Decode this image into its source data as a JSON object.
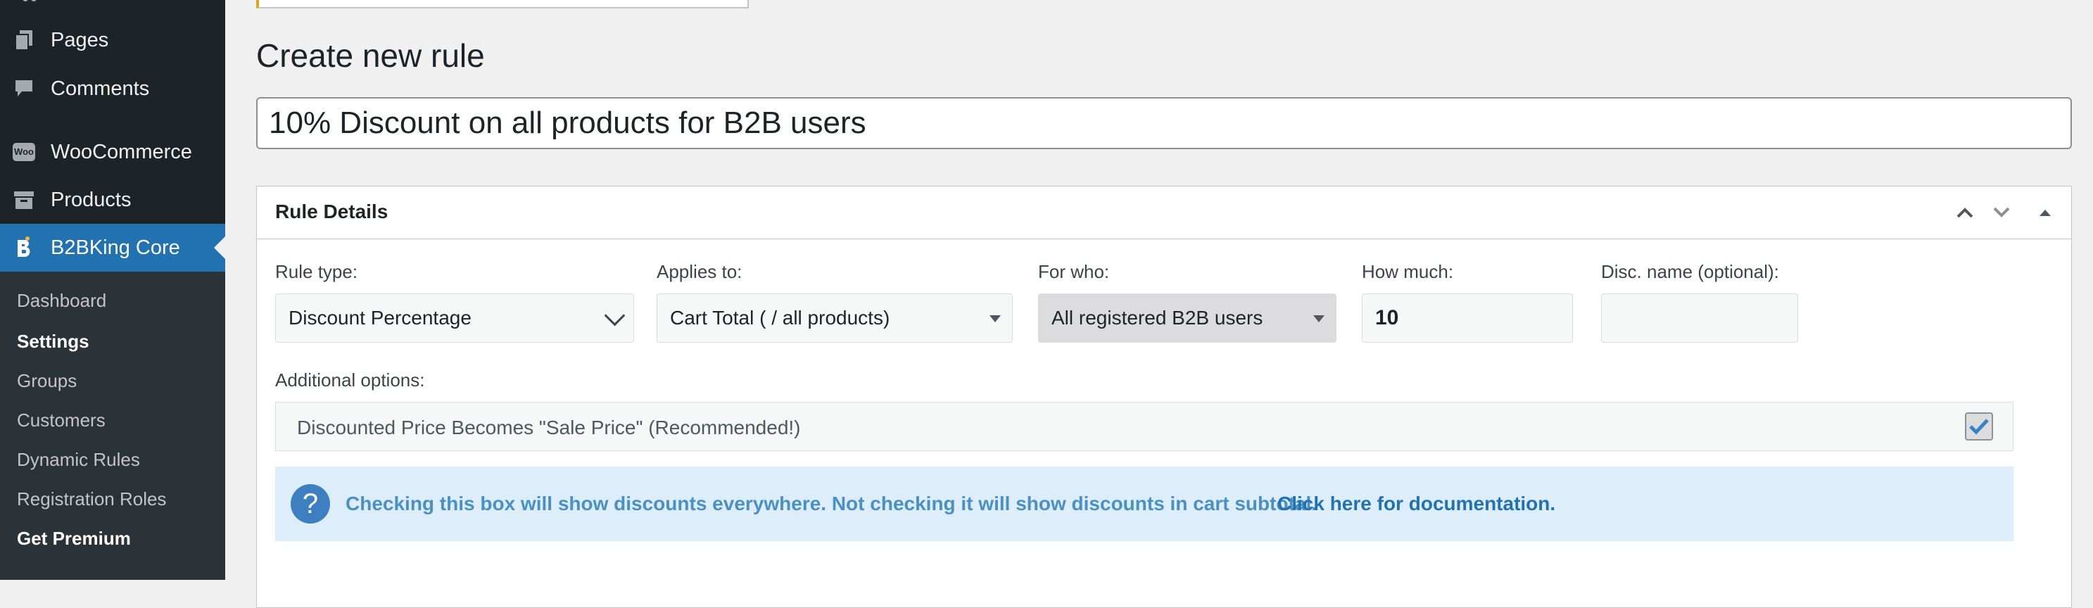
{
  "sidebar": {
    "items": [
      {
        "label": "Pages",
        "icon": "pages-icon"
      },
      {
        "label": "Comments",
        "icon": "comment-icon"
      },
      {
        "label": "WooCommerce",
        "icon": "woocommerce-icon",
        "icon_text": "Woo"
      },
      {
        "label": "Products",
        "icon": "products-icon"
      },
      {
        "label": "B2BKing Core",
        "icon": "b2bking-icon",
        "active": true
      }
    ],
    "submenu": [
      {
        "label": "Dashboard"
      },
      {
        "label": "Settings",
        "current": true
      },
      {
        "label": "Groups"
      },
      {
        "label": "Customers"
      },
      {
        "label": "Dynamic Rules"
      },
      {
        "label": "Registration Roles"
      },
      {
        "label": "Get Premium"
      }
    ]
  },
  "main": {
    "page_title": "Create new rule",
    "rule_title": "10% Discount on all products for B2B users",
    "postbox": {
      "title": "Rule Details",
      "fields": {
        "rule_type": {
          "label": "Rule type:",
          "value": "Discount Percentage"
        },
        "applies_to": {
          "label": "Applies to:",
          "value": "Cart Total ( / all products)"
        },
        "for_who": {
          "label": "For who:",
          "value": "All registered B2B users"
        },
        "how_much": {
          "label": "How much:",
          "value": "10"
        },
        "disc_name": {
          "label": "Disc. name (optional):",
          "value": ""
        }
      },
      "additional": {
        "label": "Additional options:",
        "option_text": "Discounted Price Becomes \"Sale Price\" (Recommended!)",
        "checked": true
      },
      "info": {
        "icon_text": "?",
        "text": "Checking this box will show discounts everywhere. Not checking it will show discounts in cart subtotal.",
        "link_text": "Click here for documentation."
      }
    }
  },
  "colors": {
    "sidebar_bg": "#1d2327",
    "submenu_bg": "#2c3338",
    "accent": "#2271b1",
    "info_bg": "#ddeefa",
    "notice_border": "#dba617"
  }
}
